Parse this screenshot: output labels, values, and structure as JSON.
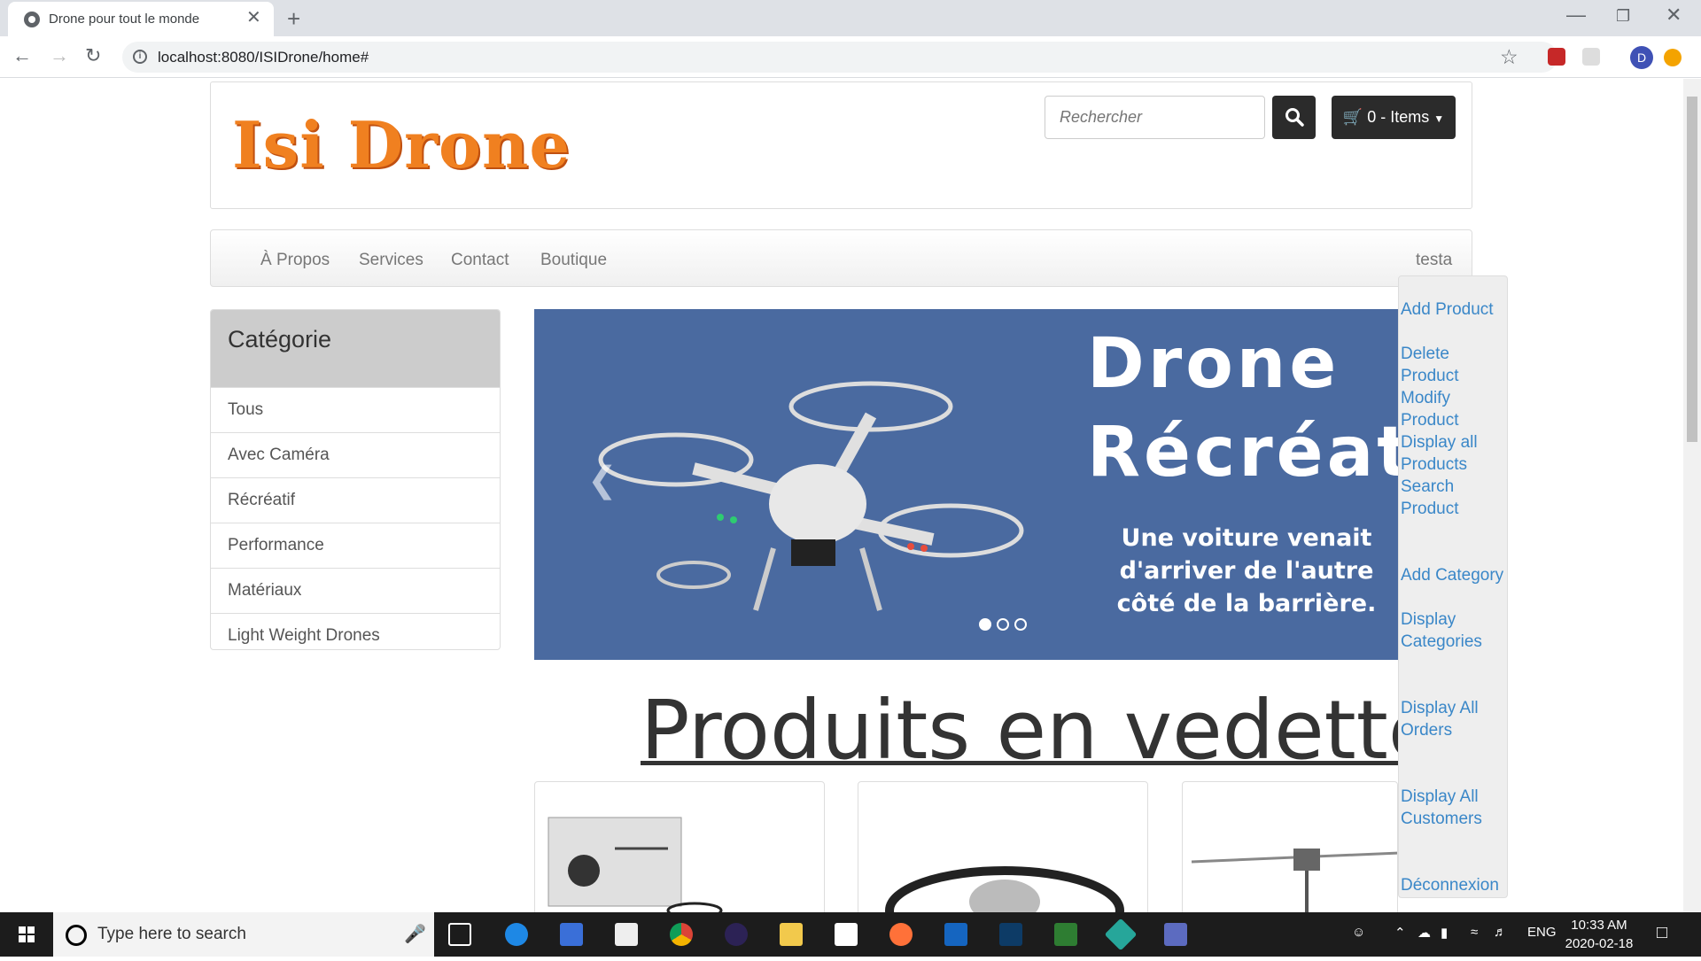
{
  "browser": {
    "tab_title": "Drone pour tout le monde",
    "tab_close": "✕",
    "new_tab": "+",
    "url": "localhost:8080/ISIDrone/home#",
    "profile_initial": "D"
  },
  "header": {
    "logo": "Isi Drone",
    "search_placeholder": "Rechercher",
    "cart_label": "0 - Items"
  },
  "nav": {
    "links": [
      "À Propos",
      "Services",
      "Contact",
      "Boutique"
    ],
    "user": "testa"
  },
  "categories": {
    "title": "Catégorie",
    "items": [
      "Tous",
      "Avec Caméra",
      "Récréatif",
      "Performance",
      "Matériaux",
      "Light Weight Drones"
    ]
  },
  "carousel": {
    "headline_line1": "Drone",
    "headline_line2": "Récréatif",
    "caption_line1": "Une voiture venait",
    "caption_line2": "d'arriver de l'autre",
    "caption_line3": "côté de la barrière.",
    "slide_count": 3,
    "active_slide": 1
  },
  "featured": {
    "title": "Produits en vedette"
  },
  "admin_menu": {
    "add_product": "Add Product",
    "delete_product": "Delete Product",
    "modify_product": "Modify Product",
    "display_all_products": "Display all Products",
    "search_product": "Search Product",
    "add_category": "Add Category",
    "display_categories": "Display Categories",
    "display_all_orders": "Display All Orders",
    "display_all_customers": "Display All Customers",
    "logout": "Déconnexion"
  },
  "taskbar": {
    "search_text": "Type here to search",
    "language": "ENG",
    "time": "10:33 AM",
    "date": "2020-02-18"
  },
  "colors": {
    "accent_link": "#3a87c8",
    "logo_orange": "#f08020",
    "carousel_bg": "#4a6aa0"
  }
}
